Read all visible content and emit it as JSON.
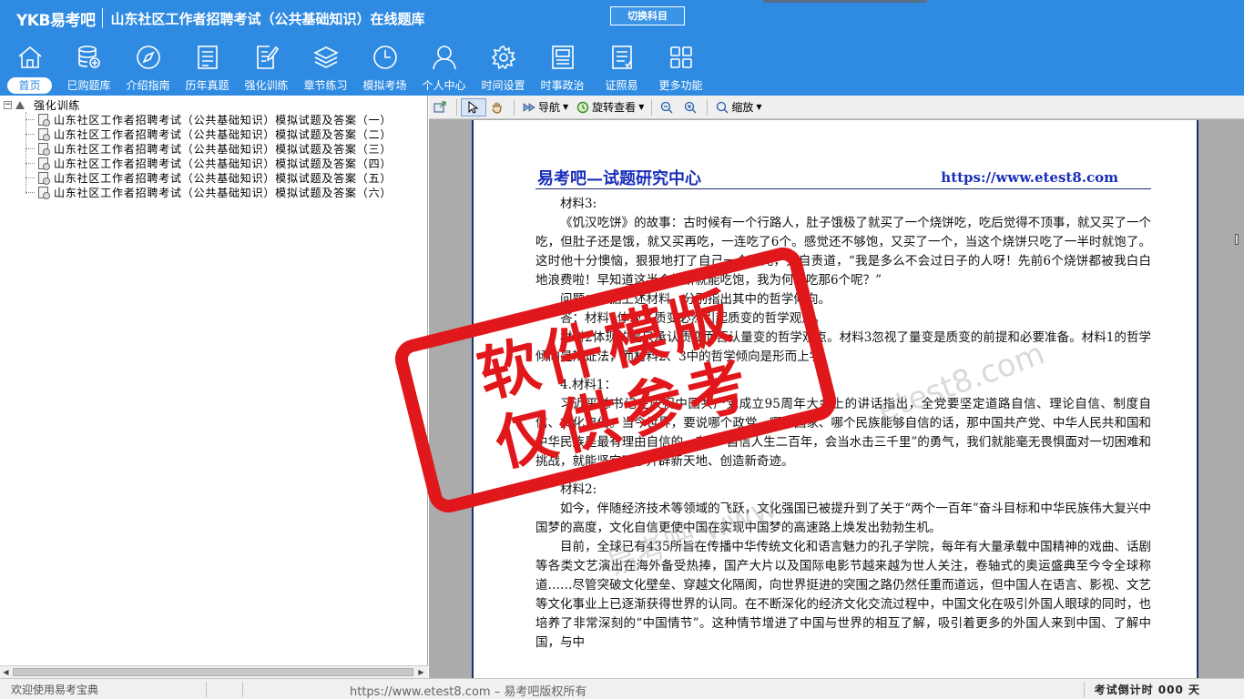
{
  "header": {
    "logo": "YKB易考吧",
    "title": "山东社区工作者招聘考试（公共基础知识）在线题库",
    "switch_label": "切换科目"
  },
  "nav": [
    {
      "label": "首页",
      "icon": "home-icon",
      "active": true
    },
    {
      "label": "已购题库",
      "icon": "database-icon",
      "active": false
    },
    {
      "label": "介绍指南",
      "icon": "compass-icon",
      "active": false
    },
    {
      "label": "历年真题",
      "icon": "list-doc-icon",
      "active": false
    },
    {
      "label": "强化训练",
      "icon": "edit-doc-icon",
      "active": false
    },
    {
      "label": "章节练习",
      "icon": "layers-icon",
      "active": false
    },
    {
      "label": "模拟考场",
      "icon": "clock-icon",
      "active": false
    },
    {
      "label": "个人中心",
      "icon": "user-icon",
      "active": false
    },
    {
      "label": "时间设置",
      "icon": "gear-icon",
      "active": false
    },
    {
      "label": "时事政治",
      "icon": "newspaper-icon",
      "active": false
    },
    {
      "label": "证照易",
      "icon": "certificate-icon",
      "active": false
    },
    {
      "label": "更多功能",
      "icon": "grid-icon",
      "active": false
    }
  ],
  "tree": {
    "root_expander": "−",
    "root": "强化训练",
    "items": [
      "山东社区工作者招聘考试（公共基础知识）模拟试题及答案（一）",
      "山东社区工作者招聘考试（公共基础知识）模拟试题及答案（二）",
      "山东社区工作者招聘考试（公共基础知识）模拟试题及答案（三）",
      "山东社区工作者招聘考试（公共基础知识）模拟试题及答案（四）",
      "山东社区工作者招聘考试（公共基础知识）模拟试题及答案（五）",
      "山东社区工作者招聘考试（公共基础知识）模拟试题及答案（六）"
    ]
  },
  "toolbar": {
    "nav_label": "导航",
    "rotate_label": "旋转查看",
    "zoom_label": "缩放"
  },
  "page": {
    "header_left": "易考吧—试题研究中心",
    "header_right": "https://www.etest8.com",
    "paragraphs": [
      "材料3:",
      "《饥汉吃饼》的故事：古时候有一个行路人，肚子饿极了就买了一个烧饼吃，吃后觉得不顶事，就又买了一个吃，但肚子还是饿，就又买再吃，一连吃了6个。感觉还不够饱，又买了一个，当这个烧饼只吃了一半时就饱了。这时他十分懊恼，狠狠地打了自己一个耳光，并自责道，“我是多么不会过日子的人呀！先前6个烧饼都被我白白地浪费啦！早知道这半个烧饼就能吃饱，我为何要吃那6个呢？”",
      "问题：依据上述材料，分别指出其中的哲学倾向。",
      "答：材料1体现了质变必然引起质变的哲学观点。",
      "材料2体现的是只承认质变而否认量变的哲学观点。材料3忽视了量变是质变的前提和必要准备。材料1的哲学倾向是辩证法，而材料2、3中的哲学倾向是形而上学。",
      "4.材料1：",
      "习近平总书记在庆祝中国共产党成立95周年大会上的讲话指出，全党要坚定道路自信、理论自信、制度自信、文化自信。当今世界，要说哪个政党、哪个国家、哪个民族能够自信的话，那中国共产党、中华人民共和国和中华民族是最有理由自信的。有了“自信人生二百年，会当水击三千里”的勇气，我们就能毫无畏惧面对一切困难和挑战，就能坚定不移开辟新天地、创造新奇迹。",
      "材料2:",
      "如今，伴随经济技术等领域的飞跃，文化强国已被提升到了关于“两个一百年”奋斗目标和中华民族伟大复兴中国梦的高度，文化自信更使中国在实现中国梦的高速路上焕发出勃勃生机。",
      "目前，全球已有435所旨在传播中华传统文化和语言魅力的孔子学院，每年有大量承载中国精神的戏曲、话剧等各类文艺演出在海外备受热捧，国产大片以及国际电影节越来越为世人关注，卷轴式的奥运盛典至今令全球称道……尽管突破文化壁垒、穿越文化隔阂，向世界挺进的突围之路仍然任重而道远，但中国人在语言、影视、文艺等文化事业上已逐渐获得世界的认同。在不断深化的经济文化交流过程中，中国文化在吸引外国人眼球的同时，也培养了非常深刻的“中国情节”。这种情节增进了中国与世界的相互了解，吸引着更多的外国人来到中国、了解中国，与中"
    ]
  },
  "watermark": {
    "stamp_line1": "软件模版",
    "stamp_line2": "仅供参考",
    "faint1": "etest8.com",
    "faint2": "易考吧 www."
  },
  "status": {
    "welcome": "欢迎使用易考宝典",
    "copyright": "https://www.etest8.com – 易考吧版权所有",
    "countdown": "考试倒计时 000 天"
  }
}
